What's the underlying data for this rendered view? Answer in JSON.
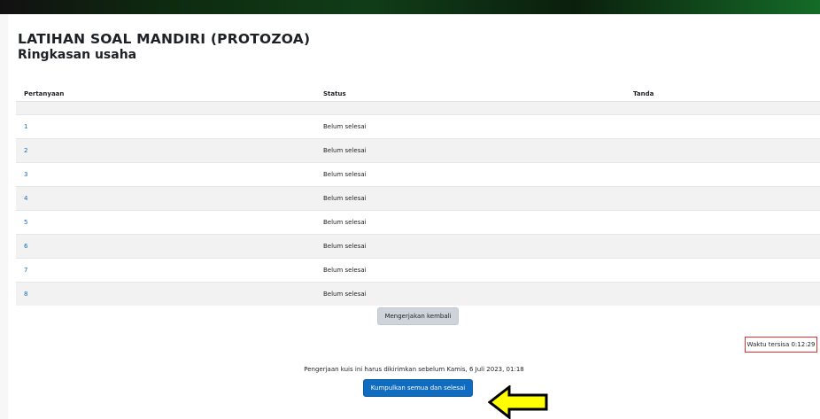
{
  "quiz": {
    "title": "LATIHAN SOAL MANDIRI (PROTOZOA)",
    "summary_title": "Ringkasan usaha"
  },
  "table": {
    "headers": [
      "Pertanyaan",
      "Status",
      "Tanda"
    ],
    "rows": [
      {
        "question": "1",
        "status": "Belum selesai"
      },
      {
        "question": "2",
        "status": "Belum selesai"
      },
      {
        "question": "3",
        "status": "Belum selesai"
      },
      {
        "question": "4",
        "status": "Belum selesai"
      },
      {
        "question": "5",
        "status": "Belum selesai"
      },
      {
        "question": "6",
        "status": "Belum selesai"
      },
      {
        "question": "7",
        "status": "Belum selesai"
      },
      {
        "question": "8",
        "status": "Belum selesai"
      }
    ]
  },
  "actions": {
    "return_label": "Mengerjakan kembali",
    "submit_label": "Kumpulkan semua dan selesai"
  },
  "timer": {
    "label": "Waktu tersisa 0:12:29"
  },
  "notice": "Pengerjaan kuis ini harus dikirimkan sebelum Kamis, 6 Juli 2023, 01:18",
  "colors": {
    "link": "#0f6cbf",
    "primary_button": "#0f6cbf",
    "secondary_button": "#ced4da",
    "timer_border": "#e03131",
    "arrow_fill": "#ffff00"
  },
  "annotation": {
    "icon": "left-arrow-icon"
  }
}
